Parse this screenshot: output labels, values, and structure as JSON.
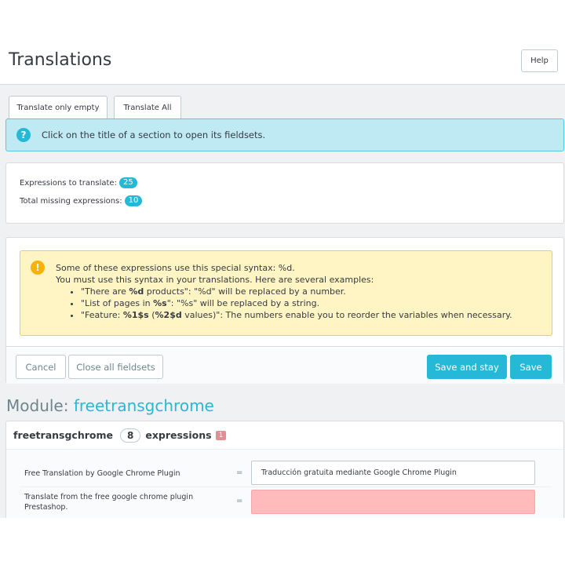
{
  "header": {
    "title": "Translations",
    "help_label": "Help"
  },
  "toolbar": {
    "translate_empty_label": "Translate only empty",
    "translate_all_label": "Translate All"
  },
  "info": {
    "icon": "question-circle-icon",
    "text": "Click on the title of a section to open its fieldsets."
  },
  "stats": {
    "to_translate_label": "Expressions to translate:",
    "to_translate_count": "25",
    "missing_label": "Total missing expressions:",
    "missing_count": "10"
  },
  "warning": {
    "icon": "exclamation-circle-icon",
    "line1": "Some of these expressions use this special syntax: %d.",
    "line2": "You must use this syntax in your translations. Here are several examples:",
    "examples": [
      {
        "pre": "\"There are ",
        "bold": "%d",
        "post": " products\": \"%d\" will be replaced by a number."
      },
      {
        "pre": "\"List of pages in ",
        "bold": "%s",
        "post": "\": \"%s\" will be replaced by a string."
      },
      {
        "pre": "\"Feature: ",
        "bold": "%1$s",
        "mid": " (",
        "bold2": "%2$d",
        "post": " values)\": The numbers enable you to reorder the variables when necessary."
      }
    ]
  },
  "footer": {
    "cancel_label": "Cancel",
    "close_all_label": "Close all fieldsets",
    "save_stay_label": "Save and stay",
    "save_label": "Save"
  },
  "module": {
    "prefix": "Module:",
    "name": "freetransgchrome",
    "section_name": "freetransgchrome",
    "expressions_count": "8",
    "expressions_label": "expressions",
    "missing_count": "1",
    "rows": [
      {
        "label": "Free Translation by Google Chrome Plugin",
        "eq": "=",
        "value": "Traducción gratuita mediante Google Chrome Plugin"
      },
      {
        "label": "Translate from the free google chrome plugin Prestashop.",
        "eq": "=",
        "value": ""
      }
    ]
  },
  "colors": {
    "accent": "#25b9d7",
    "info_bg": "#bfeaf4",
    "warning_bg": "#fff5c4",
    "missing_bg": "#ffbbbb",
    "missing_badge": "#e08f95"
  }
}
